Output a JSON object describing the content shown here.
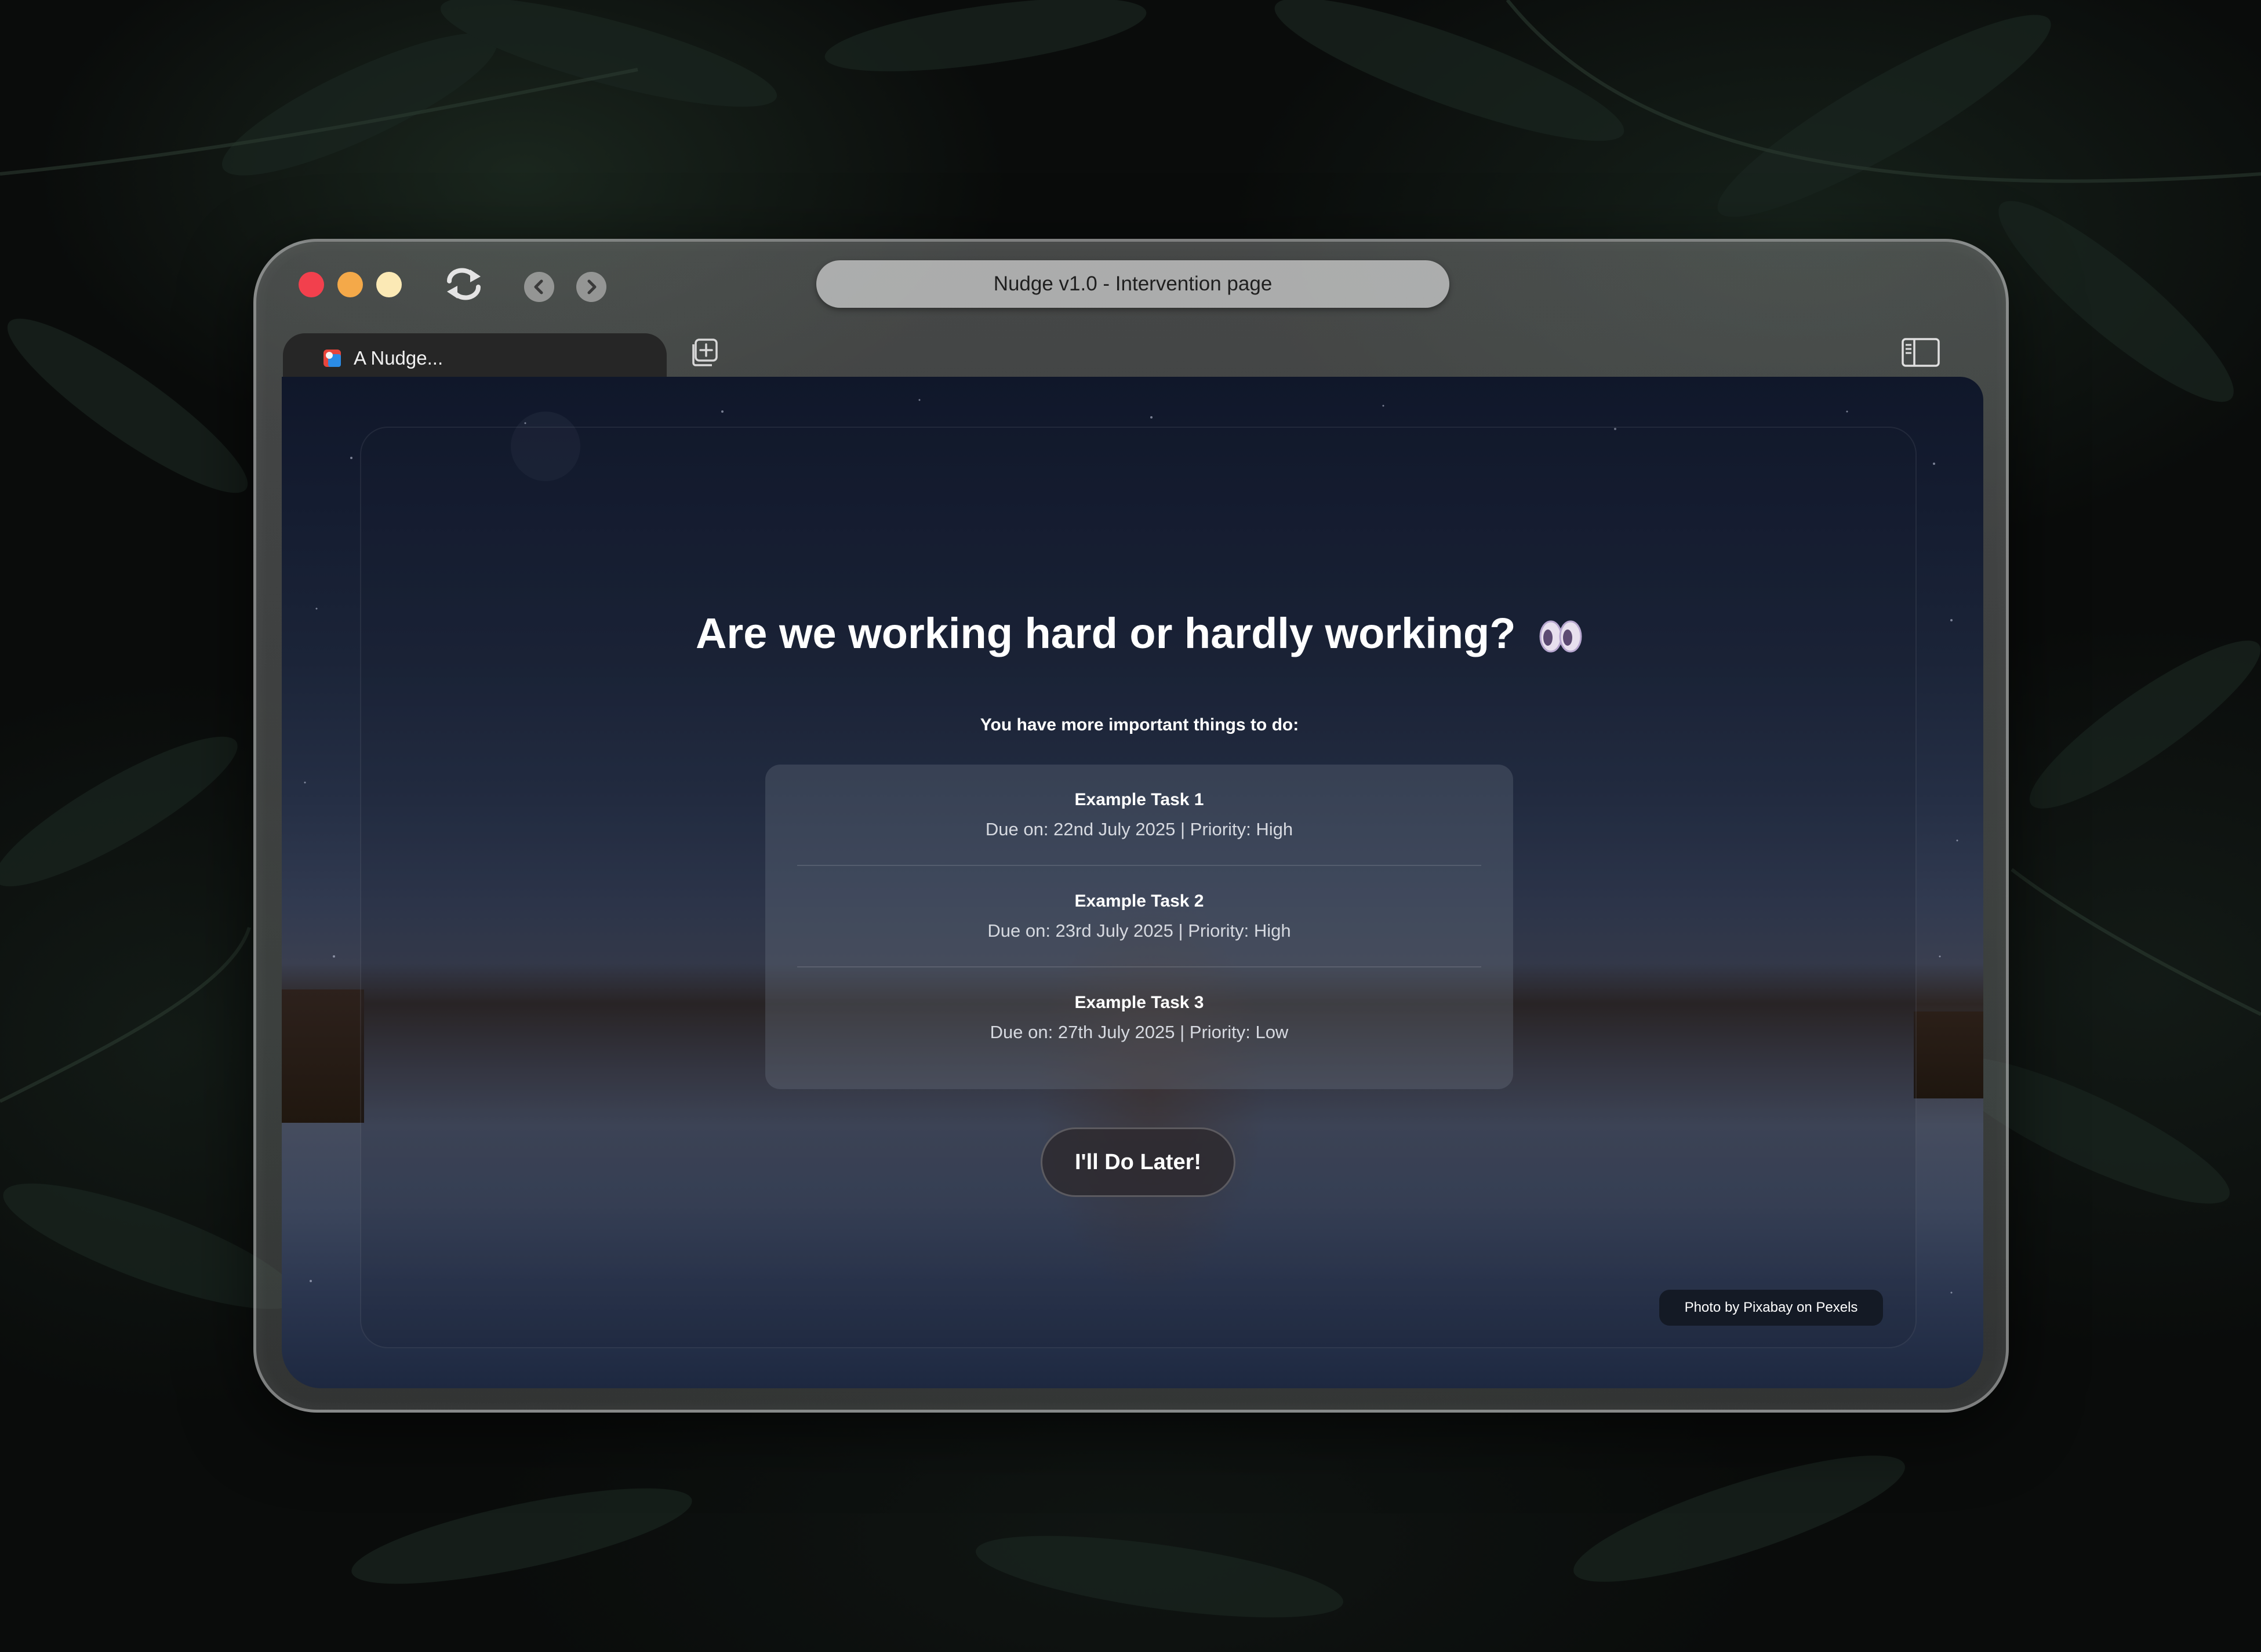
{
  "browser": {
    "address_title": "Nudge v1.0 - Intervention page",
    "tab": {
      "title": "A Nudge...",
      "favicon": "nudge-favicon-icon"
    },
    "controls": [
      "close-dot",
      "minimize-dot",
      "maximize-dot",
      "refresh-icon",
      "back-icon",
      "forward-icon",
      "new-tab-icon",
      "sidebar-toggle-icon"
    ],
    "traffic_colors": {
      "close": "#f2404d",
      "minimize": "#f4a949",
      "maximize": "#fbe9b5"
    }
  },
  "page": {
    "heading": "Are we working hard or hardly working?",
    "heading_emoji": "eyes-icon",
    "subheading": "You have more important things to do:",
    "tasks": [
      {
        "name": "Example Task 1",
        "meta": "Due on: 22nd July 2025 | Priority: High"
      },
      {
        "name": "Example Task 2",
        "meta": "Due on: 23rd July 2025 | Priority: High"
      },
      {
        "name": "Example Task 3",
        "meta": "Due on: 27th July 2025 | Priority: Low"
      }
    ],
    "action_button": "I'll Do Later!",
    "credit": "Photo by Pixabay on Pexels"
  }
}
